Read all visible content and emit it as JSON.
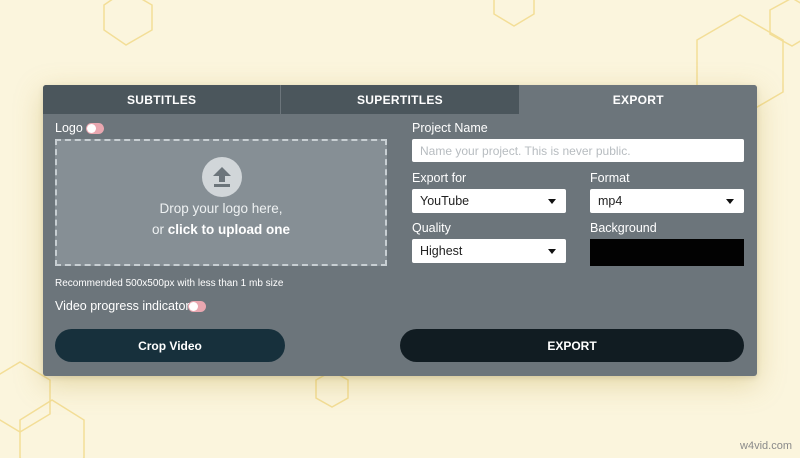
{
  "tabs": [
    {
      "label": "SUBTITLES"
    },
    {
      "label": "SUPERTITLES"
    },
    {
      "label": "EXPORT"
    }
  ],
  "active_tab": "EXPORT",
  "logo": {
    "label": "Logo",
    "toggle_on": false,
    "drop_text": "Drop your logo here,",
    "drop_or": "or",
    "drop_link": "click to upload one",
    "recommendation": "Recommended 500x500px with less than 1 mb size"
  },
  "progress_indicator": {
    "label": "Video progress indicator",
    "toggle_on": false
  },
  "project_name": {
    "label": "Project Name",
    "placeholder": "Name your project. This is never public.",
    "value": ""
  },
  "export_for": {
    "label": "Export for",
    "value": "YouTube"
  },
  "format": {
    "label": "Format",
    "value": "mp4"
  },
  "quality": {
    "label": "Quality",
    "value": "Highest"
  },
  "background": {
    "label": "Background",
    "color": "#020202"
  },
  "buttons": {
    "crop": "Crop Video",
    "export": "EXPORT"
  },
  "watermark": "w4vid.com",
  "icons": {
    "upload": "upload-arrow-icon",
    "caret": "chevron-down-icon"
  },
  "colors": {
    "page_bg": "#fbf5dd",
    "panel_bg": "#6c757b",
    "tab_inactive": "#4b565c",
    "toggle": "#e9a7b0",
    "crop_button": "#17303c",
    "export_button": "#111c22"
  }
}
